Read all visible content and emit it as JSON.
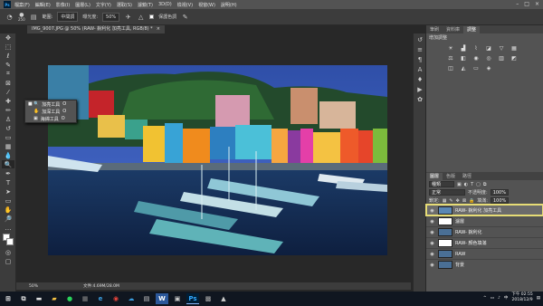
{
  "menubar": {
    "logo": "Ps",
    "items": [
      "檔案(F)",
      "編輯(E)",
      "影像(I)",
      "圖層(L)",
      "文字(Y)",
      "選取(S)",
      "濾鏡(T)",
      "3D(D)",
      "檢視(V)",
      "視窗(W)",
      "說明(H)"
    ]
  },
  "options": {
    "brush_size": "250",
    "range_label": "範圍:",
    "range_value": "中間調",
    "exposure_label": "曝光度:",
    "exposure_value": "50%",
    "protect_label": "保護色調"
  },
  "document_tab": {
    "title": "IMG_9007.JPG @ 50% (RAW- 銳利化 加亮工具, RGB/8) *"
  },
  "flyout": {
    "items": [
      {
        "label": "加亮工具",
        "key": "O",
        "active": true
      },
      {
        "label": "加深工具",
        "key": "O",
        "active": false
      },
      {
        "label": "海綿工具",
        "key": "O",
        "active": false
      }
    ]
  },
  "status": {
    "zoom": "50%",
    "doc": "文件:4.69M/28.0M"
  },
  "panels": {
    "top_tabs": [
      "筆刷",
      "資料庫",
      "調整"
    ],
    "adjust_heading": "增加調整",
    "layer_tabs": [
      "圖層",
      "色版",
      "路徑"
    ],
    "kind_value": "種類",
    "blend_value": "正常",
    "opacity_label": "不透明度:",
    "opacity_value": "100%",
    "lock_label": "鎖定:",
    "fill_label": "填滿:",
    "fill_value": "100%",
    "layers": [
      {
        "name": "RAW- 銳利化 加亮工具",
        "selected": true,
        "color": "#5a87b5"
      },
      {
        "name": "濾層",
        "selected": false,
        "color": "#ffffff"
      },
      {
        "name": "RAW- 銳利化",
        "selected": false,
        "color": "#4a6f95"
      },
      {
        "name": "RAW- 顏色填滿",
        "selected": false,
        "color": "#ffffff"
      },
      {
        "name": "RAW",
        "selected": false,
        "color": "#4a6f95"
      },
      {
        "name": "背景",
        "selected": false,
        "color": "#4a6f95"
      }
    ]
  },
  "taskbar": {
    "time": "下午 02:55",
    "date": "2018/12/9",
    "lang": "中"
  }
}
